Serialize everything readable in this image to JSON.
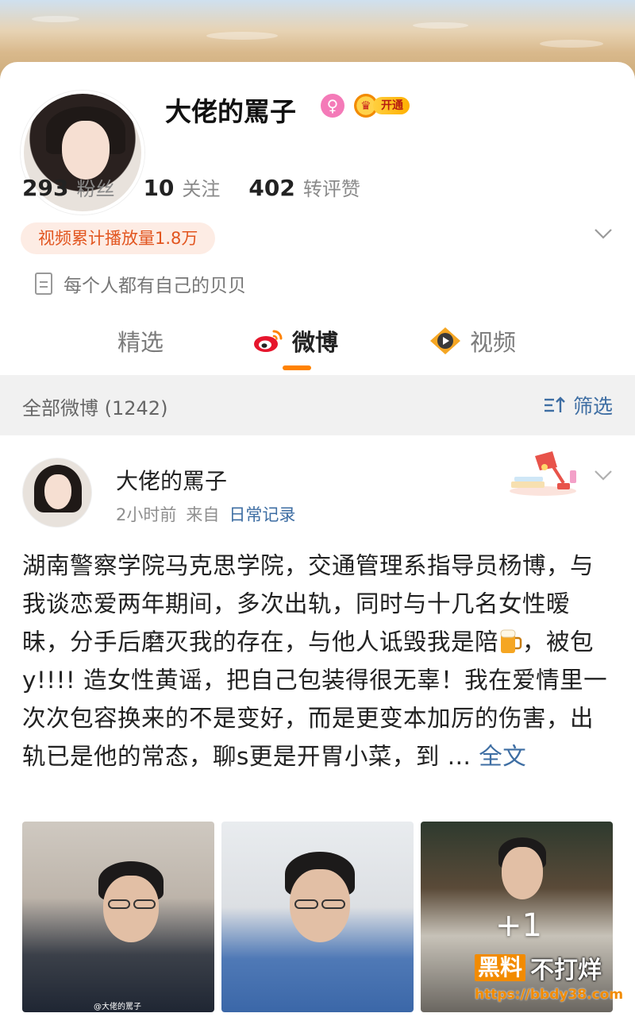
{
  "profile": {
    "name": "大佬的罵子",
    "vip_label": "开通",
    "stats": [
      {
        "value": "293",
        "label": "粉丝"
      },
      {
        "value": "10",
        "label": "关注"
      },
      {
        "value": "402",
        "label": "转评赞"
      }
    ],
    "video_plays": "视频累计播放量1.8万",
    "bio": "每个人都有自己的贝贝"
  },
  "tabs": [
    {
      "label": "精选"
    },
    {
      "label": "微博"
    },
    {
      "label": "视频"
    }
  ],
  "filter_bar": {
    "all_label": "全部微博 (1242)",
    "filter_label": "筛选"
  },
  "post": {
    "author": "大佬的罵子",
    "time": "2小时前",
    "from_prefix": "来自",
    "source": "日常记录",
    "text_part1": "湖南警察学院马克思学院，交通管理系指导员杨博，与我谈恋爱两年期间，多次出轨，同时与十几名女性暧昧，分手后磨灭我的存在，与他人诋毁我是陪",
    "text_part2": "，被包y!!!! 造女性黄谣，把自己包装得很无辜！我在爱情里一次次包容换来的不是变好，而是更变本加厉的伤害，出轨已是他的常态，聊s更是开胃小菜，到 ... ",
    "more_label": "全文",
    "photo_more": "+1",
    "photo_watermark": "@大佬的罵子"
  },
  "overlay_watermark": {
    "brand_a": "黑料",
    "brand_b": "不打烊",
    "url": "https://bbdy38.com"
  },
  "colors": {
    "accent": "#ff8200",
    "link": "#3e6ea3",
    "pill_bg": "#fdece4",
    "pill_text": "#e2551f"
  },
  "icons": [
    "female-icon",
    "vip-crown-icon",
    "chevron-down-icon",
    "document-icon",
    "weibo-logo-icon",
    "video-play-icon",
    "filter-sort-icon",
    "desk-lamp-icon",
    "beer-emoji"
  ]
}
